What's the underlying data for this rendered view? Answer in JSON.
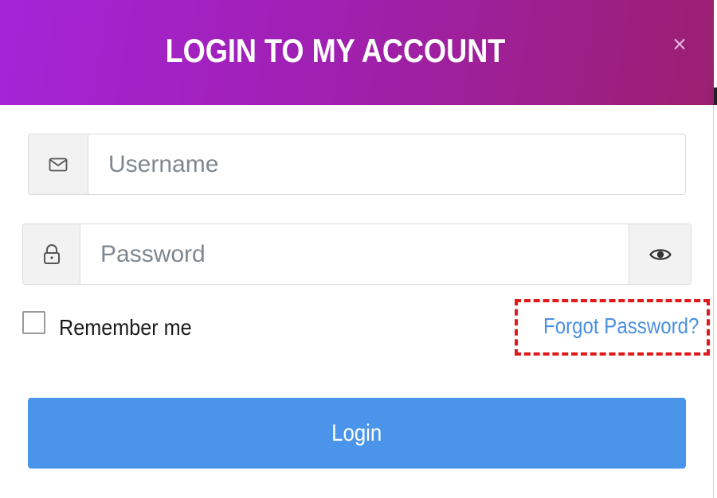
{
  "modal": {
    "title": "LOGIN TO MY ACCOUNT",
    "close_icon": "×"
  },
  "form": {
    "username": {
      "placeholder": "Username",
      "value": "",
      "icon": "envelope-icon"
    },
    "password": {
      "placeholder": "Password",
      "value": "",
      "icon": "lock-icon",
      "toggle_icon": "eye-icon"
    },
    "remember": {
      "label": "Remember me",
      "checked": false
    },
    "forgot_password": "Forgot Password?",
    "submit_label": "Login"
  },
  "colors": {
    "header_gradient_start": "#a524d8",
    "header_gradient_end": "#9b1f70",
    "link": "#4a90e2",
    "button": "#4a94ea",
    "highlight_dashed_border": "#e01a1a"
  }
}
